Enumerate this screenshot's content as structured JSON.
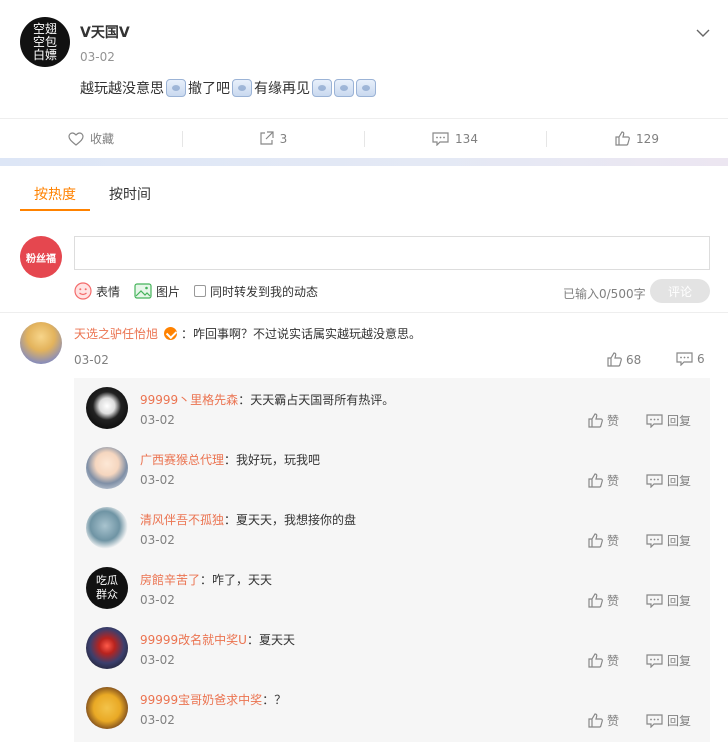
{
  "post": {
    "author": "V天国V",
    "avatar_text": "空翅空包白嫖",
    "date": "03-02",
    "text_parts": [
      "越玩越没意思",
      "撤了吧",
      "有缘再见"
    ],
    "actions": {
      "favorite": "收藏",
      "repost": "3",
      "comment": "134",
      "like": "129"
    }
  },
  "tabs": [
    {
      "label": "按热度"
    },
    {
      "label": "按时间"
    }
  ],
  "composer": {
    "avatar_text": "粉丝福",
    "input_placeholder": "",
    "emoji_label": "表情",
    "image_label": "图片",
    "forward_label": "同时转发到我的动态",
    "counter": "已输入0/500字",
    "submit": "评论"
  },
  "comment": {
    "nick": "天选之驴任怡旭",
    "text": "：咋回事啊？不过说实话属实越玩越没意思。",
    "date": "03-02",
    "likes": "68",
    "replies_count": "6"
  },
  "replies": [
    {
      "nick": "99999丶里格先森",
      "text": "：天天霸占天国哥所有热评。",
      "date": "03-02",
      "like": "赞",
      "reply": "回复"
    },
    {
      "nick": "广西赛猴总代理",
      "text": "：我好玩，玩我吧",
      "date": "03-02",
      "like": "赞",
      "reply": "回复"
    },
    {
      "nick": "清风伴吾不孤独",
      "text": "：夏天天，我想接你的盘",
      "date": "03-02",
      "like": "赞",
      "reply": "回复"
    },
    {
      "nick": "房館辛苦了",
      "text": "：咋了，天天",
      "date": "03-02",
      "like": "赞",
      "reply": "回复",
      "avatar_text": "吃瓜群众"
    },
    {
      "nick": "99999改名就中奖U",
      "text": "：夏天天",
      "date": "03-02",
      "like": "赞",
      "reply": "回复"
    },
    {
      "nick": "99999宝哥奶爸求中奖",
      "text": "：？",
      "date": "03-02",
      "like": "赞",
      "reply": "回复"
    }
  ],
  "colors": {
    "accent": "#ff8200",
    "nick": "#eb7350",
    "muted": "#808080"
  }
}
